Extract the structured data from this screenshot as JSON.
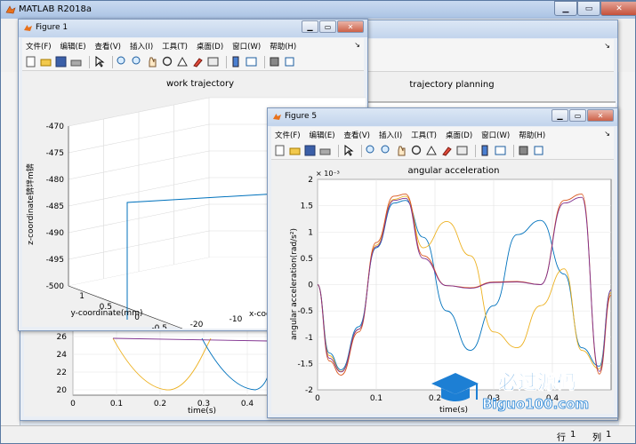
{
  "app": {
    "title": "MATLAB R2018a",
    "status_row_label": "行",
    "status_row_value": "1",
    "status_col_label": "列",
    "status_col_value": "1"
  },
  "menu_items": [
    "文件(F)",
    "编辑(E)",
    "查看(V)",
    "插入(I)",
    "工具(T)",
    "桌面(D)",
    "窗口(W)",
    "帮助(H)"
  ],
  "icons": [
    "new-file-icon",
    "open-folder-icon",
    "save-icon",
    "print-icon",
    "pointer-icon",
    "zoom-in-icon",
    "zoom-out-icon",
    "pan-hand-icon",
    "rotate-3d-icon",
    "data-cursor-icon",
    "brush-icon",
    "link-plot-icon",
    "colorbar-icon",
    "legend-icon",
    "hide-plot-tools-icon",
    "show-plot-tools-icon"
  ],
  "colors": {
    "series_blue": "#0072bd",
    "series_orange": "#edb120",
    "series_red": "#d95319",
    "series_purple": "#7e2f8e",
    "series_green": "#77ac30",
    "title_bar": "#c2d4ec"
  },
  "figure1": {
    "title": "Figure 1",
    "chart_data": {
      "type": "line",
      "title": "work trajectory",
      "zlabel": "z-coordinate锛坢m锛",
      "ylabel": "y-coordinate(mm)",
      "xlabel": "x-coo",
      "z_ticks": [
        "-470",
        "-475",
        "-480",
        "-485",
        "-490",
        "-495",
        "-500"
      ],
      "y_ticks": [
        "1",
        "0.5",
        "0",
        "-0.5",
        "-1"
      ],
      "x_ticks": [
        "-20",
        "-10",
        "0"
      ],
      "zlim": [
        -500,
        -470
      ],
      "series": [
        {
          "points": [
            {
              "x": -20,
              "y": 0,
              "z": -500
            },
            {
              "x": -20,
              "y": 0,
              "z": -478
            },
            {
              "x": 0,
              "y": 0,
              "z": -478
            },
            {
              "x": 0,
              "y": 0,
              "z": -470
            }
          ]
        }
      ]
    }
  },
  "figure_behind": {
    "chart_data": {
      "type": "line",
      "title": "trajectory planning",
      "xlabel": "time(s)",
      "x_ticks": [
        "0",
        "0.1",
        "0.2",
        "0.3",
        "0.4"
      ],
      "y_ticks": [
        "26",
        "24",
        "22",
        "20"
      ],
      "ylim": [
        20,
        27
      ],
      "left_label": "详"
    }
  },
  "figure5": {
    "title": "Figure 5",
    "chart_data": {
      "type": "line",
      "title": "angular acceleration",
      "xlabel": "time(s)",
      "ylabel": "angular acceleration(rad/s²)",
      "exponent_label": "× 10⁻³",
      "xlim": [
        0,
        0.5
      ],
      "ylim": [
        -2,
        2
      ],
      "x_ticks": [
        "0",
        "0.1",
        "0.2",
        "0.3",
        "0.4"
      ],
      "y_ticks": [
        "2",
        "1.5",
        "1",
        "0.5",
        "0",
        "-0.5",
        "-1",
        "-1.5",
        "-2"
      ],
      "x_tick_values": [
        0,
        0.1,
        0.2,
        0.3,
        0.4
      ],
      "y_tick_values": [
        2,
        1.5,
        1,
        0.5,
        0,
        -0.5,
        -1,
        -1.5,
        -2
      ],
      "series": [
        {
          "color": "#0072bd",
          "x": [
            0,
            0.02,
            0.04,
            0.07,
            0.1,
            0.13,
            0.15,
            0.18,
            0.22,
            0.26,
            0.3,
            0.34,
            0.38,
            0.42,
            0.45,
            0.48,
            0.5
          ],
          "y": [
            0,
            -1.3,
            -1.62,
            -0.8,
            0.7,
            1.55,
            1.6,
            0.9,
            -0.5,
            -1.25,
            -0.4,
            0.95,
            1.22,
            0.2,
            -1.2,
            -1.55,
            -0.1
          ]
        },
        {
          "color": "#edb120",
          "x": [
            0,
            0.02,
            0.04,
            0.07,
            0.1,
            0.13,
            0.15,
            0.18,
            0.22,
            0.26,
            0.3,
            0.34,
            0.38,
            0.42,
            0.45,
            0.48,
            0.5
          ],
          "y": [
            0,
            -1.35,
            -1.65,
            -0.85,
            0.75,
            1.62,
            1.68,
            0.7,
            1.2,
            0.55,
            -0.9,
            -1.2,
            -0.4,
            0.3,
            -1.25,
            -1.6,
            -0.15
          ]
        },
        {
          "color": "#d95319",
          "x": [
            0,
            0.02,
            0.04,
            0.07,
            0.1,
            0.13,
            0.15,
            0.18,
            0.22,
            0.26,
            0.3,
            0.34,
            0.38,
            0.42,
            0.45,
            0.48,
            0.5
          ],
          "y": [
            0,
            -1.45,
            -1.72,
            -0.9,
            0.8,
            1.68,
            1.72,
            0.55,
            -0.02,
            -0.06,
            0.05,
            0.06,
            0.0,
            1.6,
            1.72,
            -1.7,
            -0.2
          ]
        },
        {
          "color": "#7e2f8e",
          "x": [
            0,
            0.02,
            0.04,
            0.07,
            0.1,
            0.13,
            0.15,
            0.18,
            0.22,
            0.26,
            0.3,
            0.34,
            0.38,
            0.42,
            0.45,
            0.48,
            0.5
          ],
          "y": [
            0,
            -1.4,
            -1.66,
            -0.85,
            0.72,
            1.6,
            1.64,
            0.5,
            -0.02,
            -0.07,
            0.04,
            0.05,
            0.0,
            1.55,
            1.66,
            -1.65,
            -0.1
          ]
        }
      ]
    }
  },
  "watermark": {
    "line1": "必过源码",
    "line2": "Biguo100.com"
  }
}
